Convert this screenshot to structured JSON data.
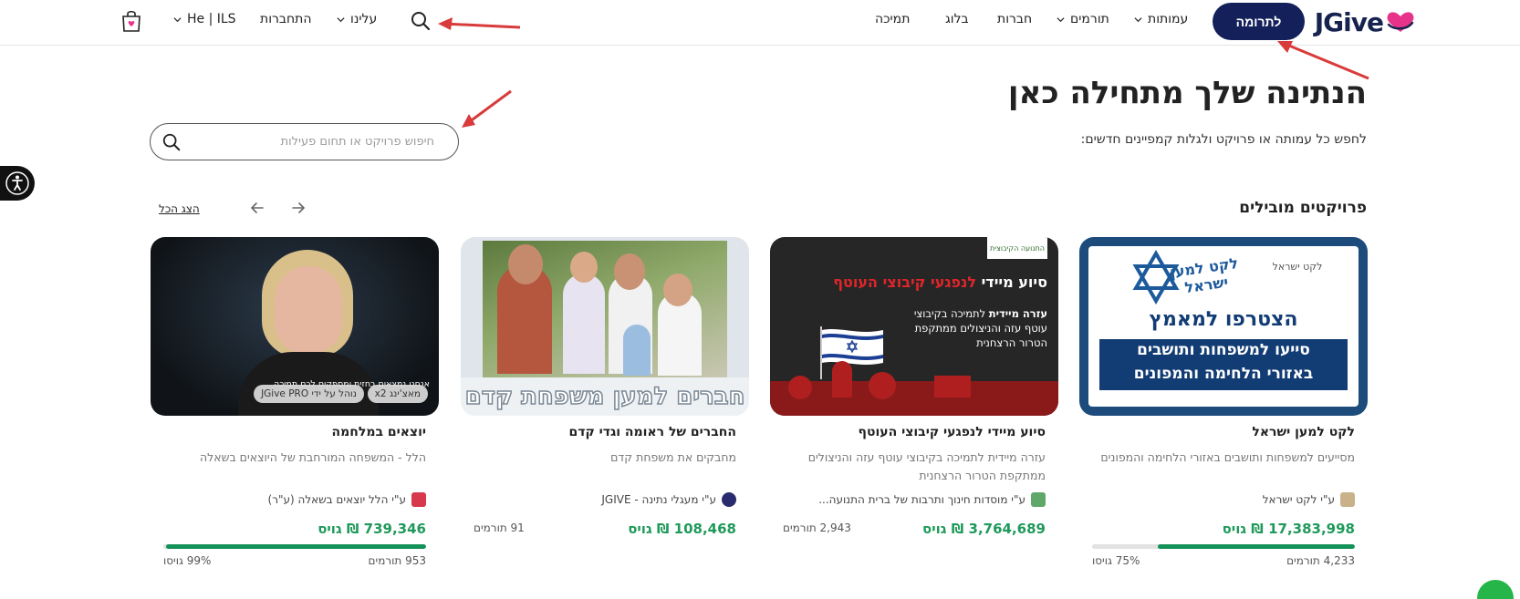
{
  "header": {
    "brand": "JGive",
    "donate_label": "לתרומה",
    "nav": {
      "amutot": "עמותות",
      "tormim": "תורמים",
      "companies": "חברות",
      "blog": "בלוג",
      "support": "תמיכה",
      "about": "עלינו",
      "login": "התחברות",
      "lang_currency": "He | ILS"
    }
  },
  "hero": {
    "title": "הנתינה שלך מתחילה כאן",
    "subtitle": "לחפש כל עמותה או פרויקט ולגלות קמפיינים חדשים:",
    "search_placeholder": "חיפוש פרויקט או תחום פעילות"
  },
  "section": {
    "title": "פרויקטים מובילים",
    "show_all": "הצג הכל"
  },
  "cards": [
    {
      "title": "לקט למען ישראל",
      "desc": "מסייעים למשפחות ותושבים באזורי הלחימה והמפונים",
      "org": "ע\"י לקט ישראל",
      "raised": "17,383,998 ₪ גויס",
      "donors": "4,233 תורמים",
      "pct": "75% גויסו",
      "progress": 0.75,
      "img": {
        "logo_name": "לקט ישראל",
        "logo_tag": "לקט למען ישראל",
        "join": "הצטרפו למאמץ",
        "line1": "סייעו למשפחות ותושבים",
        "line2": "באזורי הלחימה והמפונים"
      }
    },
    {
      "title": "סיוע מיידי לנפגעי קיבוצי העוטף",
      "desc": "עזרה מיידית לתמיכה בקיבוצי עוטף עזה והניצולים ממתקפת הטרור הרצחנית",
      "org": "ע\"י מוסדות חינוך ותרבות של ברית התנועה...",
      "raised": "3,764,689 ₪ גויס",
      "donors_inline": "2,943 תורמים",
      "img": {
        "headline_a": "סיוע מיידי ",
        "headline_b": "לנפגעי קיבוצי העוטף",
        "body_bold": "עזרה מיידית",
        "body_rest": " לתמיכה בקיבוצי עוטף עזה והניצולים ממתקפת הטרור הרצחנית",
        "logo": "התנועה הקיבוצית"
      }
    },
    {
      "title": "החברים של ראומה וגדי קדם",
      "desc": "מחבקים את משפחת קדם",
      "org": "ע\"י מעגלי נתינה - JGIVE",
      "raised": "108,468 ₪ גויס",
      "donors_inline": "91 תורמים",
      "img": {
        "banner": "חברים למען משפחת קדם"
      }
    },
    {
      "title": "יוצאים במלחמה",
      "desc": "הלל - המשפחה המורחבת של היוצאים בשאלה",
      "org": "ע\"י הלל יוצאים בשאלה (ע\"ר)",
      "raised": "739,346 ₪ גויס",
      "donors": "953 תורמים",
      "pct": "99% גויסו",
      "progress": 0.99,
      "img": {
        "badge_match": "מאצ'ינג x2",
        "badge_pro": "נוהל על ידי JGive PRO",
        "caption": "אנחנו נמצאים בחזית ומספקים לכם תמיכה"
      }
    }
  ],
  "colors": {
    "brand_navy": "#13205a",
    "raised_green": "#1f9a5b",
    "progress_green": "#14925a",
    "heart_pink": "#e8338a"
  }
}
